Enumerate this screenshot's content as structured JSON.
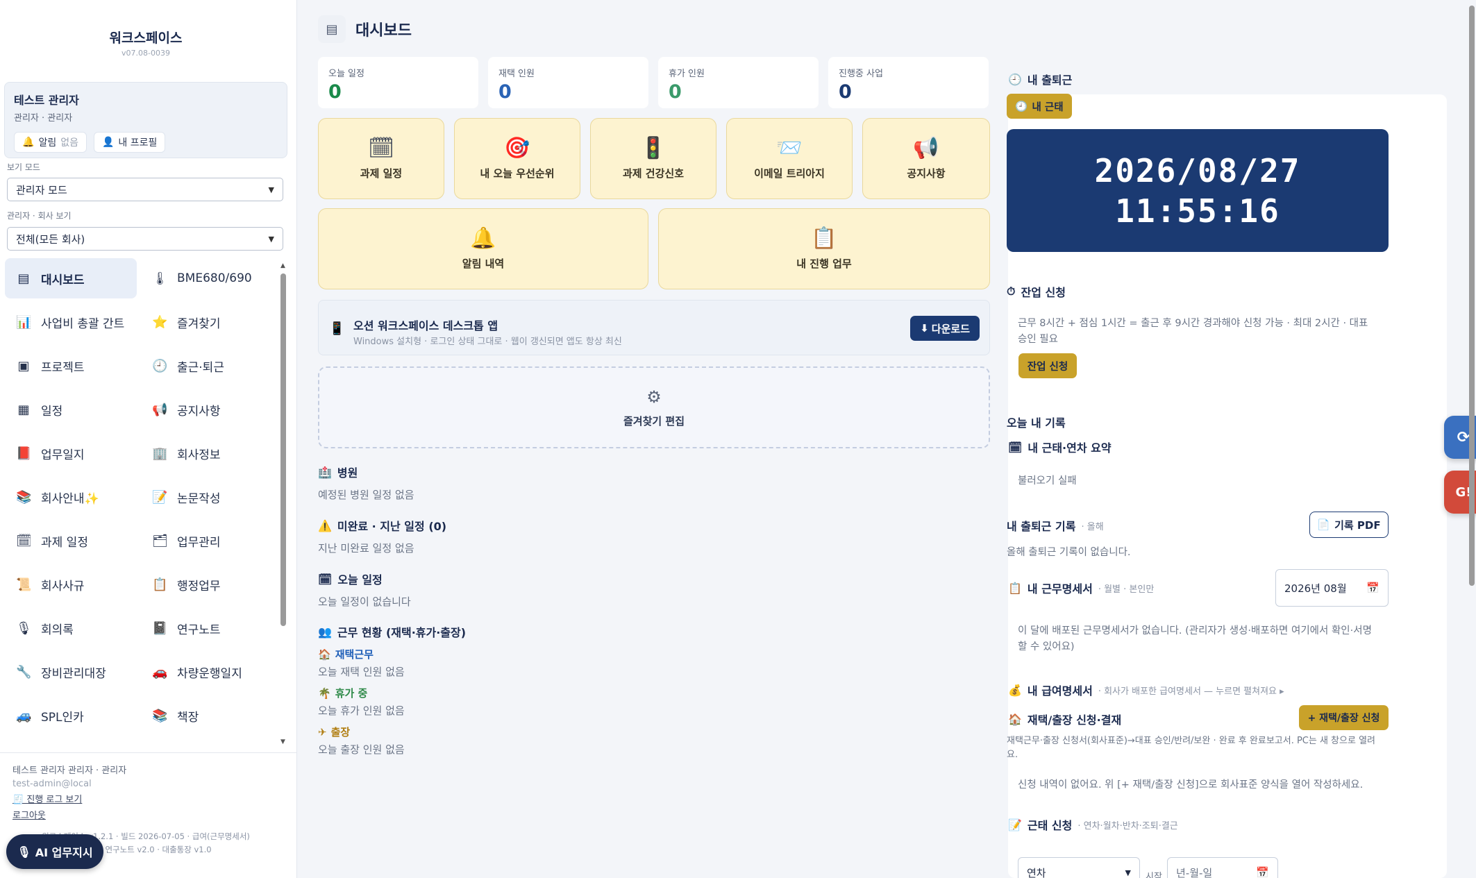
{
  "sidebar": {
    "brand": "워크스페이스",
    "version": "v07.08-0039",
    "user": {
      "name": "테스트 관리자",
      "role": "관리자 · 관리자",
      "alerts_label": "알림",
      "alerts_value": "없음",
      "profile_label": "내 프로필"
    },
    "view_mode_label": "보기 모드",
    "view_mode_value": "관리자 모드",
    "company_view_label": "관리자 · 회사 보기",
    "company_view_value": "전체(모든 회사)",
    "nav": [
      {
        "label": "대시보드",
        "icon": "▤"
      },
      {
        "label": "BME680/690",
        "icon": "🌡"
      },
      {
        "label": "사업비 총괄 간트",
        "icon": "📊"
      },
      {
        "label": "즐겨찾기",
        "icon": "⭐"
      },
      {
        "label": "프로젝트",
        "icon": "▣"
      },
      {
        "label": "출근·퇴근",
        "icon": "🕘"
      },
      {
        "label": "일정",
        "icon": "▦"
      },
      {
        "label": "공지사항",
        "icon": "📢"
      },
      {
        "label": "업무일지",
        "icon": "📕"
      },
      {
        "label": "회사정보",
        "icon": "🏢"
      },
      {
        "label": "회사안내✨",
        "icon": "📚"
      },
      {
        "label": "논문작성",
        "icon": "📝"
      },
      {
        "label": "과제 일정",
        "icon": "🗓"
      },
      {
        "label": "업무관리",
        "icon": "🗂"
      },
      {
        "label": "회사사규",
        "icon": "📜"
      },
      {
        "label": "행정업무",
        "icon": "📋"
      },
      {
        "label": "회의록",
        "icon": "🎙"
      },
      {
        "label": "연구노트",
        "icon": "📓"
      },
      {
        "label": "장비관리대장",
        "icon": "🔧"
      },
      {
        "label": "차량운행일지",
        "icon": "🚗"
      },
      {
        "label": "SPL인카",
        "icon": "🚙"
      },
      {
        "label": "책장",
        "icon": "📚"
      }
    ],
    "footer": {
      "who": "테스트 관리자 관리자 · 관리자",
      "email": "test-admin@local",
      "log_link": "🧾 진행 로그 보기",
      "logout": "로그아웃"
    },
    "build_info": "워크스페이스 v1.2.1 · 빌드 2026-07-05 · 급여(근무명세서) v1.0 · 연구노트 v2.0 · 대출통장 v1.0",
    "ai_button": "AI 업무지시"
  },
  "header": {
    "title": "대시보드"
  },
  "stats": [
    {
      "label": "오늘 일정",
      "value": "0",
      "color": "#1a8a4a"
    },
    {
      "label": "재택 인원",
      "value": "0",
      "color": "#2a63b5"
    },
    {
      "label": "휴가 인원",
      "value": "0",
      "color": "#3a9a6a"
    },
    {
      "label": "진행중 사업",
      "value": "0",
      "color": "#1b3a72"
    }
  ],
  "tiles": [
    {
      "label": "과제 일정",
      "icon": "🗓"
    },
    {
      "label": "내 오늘 우선순위",
      "icon": "🎯"
    },
    {
      "label": "과제 건강신호",
      "icon": "🚦"
    },
    {
      "label": "이메일 트리아지",
      "icon": "📨"
    },
    {
      "label": "공지사항",
      "icon": "📢"
    },
    {
      "label": "알림 내역",
      "icon": "🔔"
    },
    {
      "label": "내 진행 업무",
      "icon": "📋"
    }
  ],
  "app_banner": {
    "title": "오션 워크스페이스 데스크톱 앱",
    "subtitle": "Windows 설치형 · 로그인 상태 그대로 · 웹이 갱신되면 앱도 항상 최신",
    "download": "다운로드"
  },
  "fav_edit": "즐겨찾기 편집",
  "sections": {
    "hospital": {
      "title": "병원",
      "empty": "예정된 병원 일정 없음"
    },
    "overdue": {
      "title": "미완료 · 지난 일정 (0)",
      "empty": "지난 미완료 일정 없음"
    },
    "today": {
      "title": "오늘 일정",
      "empty": "오늘 일정이 없습니다"
    },
    "work_status": {
      "title": "근무 현황 (재택·휴가·출장)",
      "remote": {
        "title": "재택근무",
        "empty": "오늘 재택 인원 없음"
      },
      "vacation": {
        "title": "휴가 중",
        "empty": "오늘 휴가 인원 없음"
      },
      "trip": {
        "title": "출장",
        "empty": "오늘 출장 인원 없음"
      }
    }
  },
  "right": {
    "commute_title": "내 출퇴근",
    "my_attendance_btn": "내 근태",
    "clock_date": "2026/08/27",
    "clock_time": "11:55:16",
    "overtime_title": "잔업 신청",
    "overtime_desc": "근무 8시간 + 점심 1시간 = 출근 후 9시간 경과해야 신청 가능 · 최대 2시간 · 대표 승인 필요",
    "overtime_btn": "잔업 신청",
    "today_record": "오늘 내 기록",
    "summary_title": "내 근태·연차 요약",
    "summary_fail": "불러오기 실패",
    "log_title": "내 출퇴근 기록",
    "log_sub": "· 올해",
    "log_pdf": "기록 PDF",
    "log_empty": "올해 출퇴근 기록이 없습니다.",
    "statement_title": "내 근무명세서",
    "statement_sub": "· 월별 · 본인만",
    "statement_month": "2026년 08월",
    "statement_empty": "이 달에 배포된 근무명세서가 없습니다. (관리자가 생성·배포하면 여기에서 확인·서명할 수 있어요)",
    "payslip_title": "내 급여명세서",
    "payslip_sub": "· 회사가 배포한 급여명세서 — 누르면 펼쳐져요 ▸",
    "remote_title": "재택/출장 신청·결재",
    "remote_btn": "+ 재택/출장 신청",
    "remote_desc": "재택근무·출장 신청서(회사표준)→대표 승인/반려/보완 · 완료 후 완료보고서. PC는 새 창으로 열려요.",
    "remote_empty": "신청 내역이 없어요. 위 [+ 재택/출장 신청]으로 회사표준 양식을 열어 작성하세요.",
    "leave_title": "근태 신청",
    "leave_sub": "· 연차·월차·반차·조퇴·결근",
    "leave_type": "연차",
    "leave_start_label": "시작",
    "leave_date_placeholder": "년-월-일"
  }
}
